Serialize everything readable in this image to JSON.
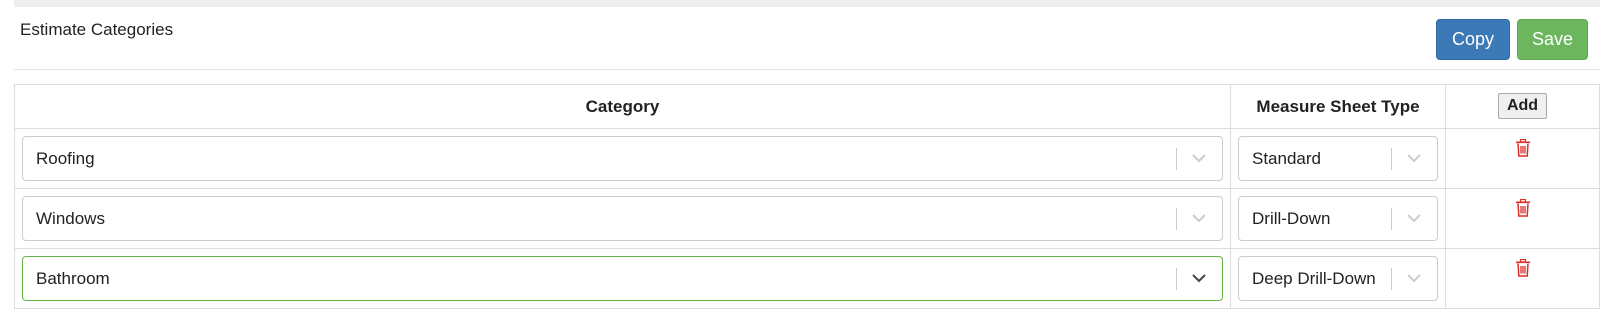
{
  "header": {
    "title": "Estimate Categories",
    "copy_label": "Copy",
    "save_label": "Save"
  },
  "table": {
    "columns": {
      "category": "Category",
      "measure_sheet_type": "Measure Sheet Type",
      "add_label": "Add"
    },
    "rows": [
      {
        "category": "Roofing",
        "type": "Standard"
      },
      {
        "category": "Windows",
        "type": "Drill-Down"
      },
      {
        "category": "Bathroom",
        "type": "Deep Drill-Down"
      }
    ]
  },
  "colors": {
    "copy_button": "#3b79b7",
    "save_button": "#6cb75d",
    "focused_border": "#66b347",
    "delete_icon": "#d9302c"
  }
}
